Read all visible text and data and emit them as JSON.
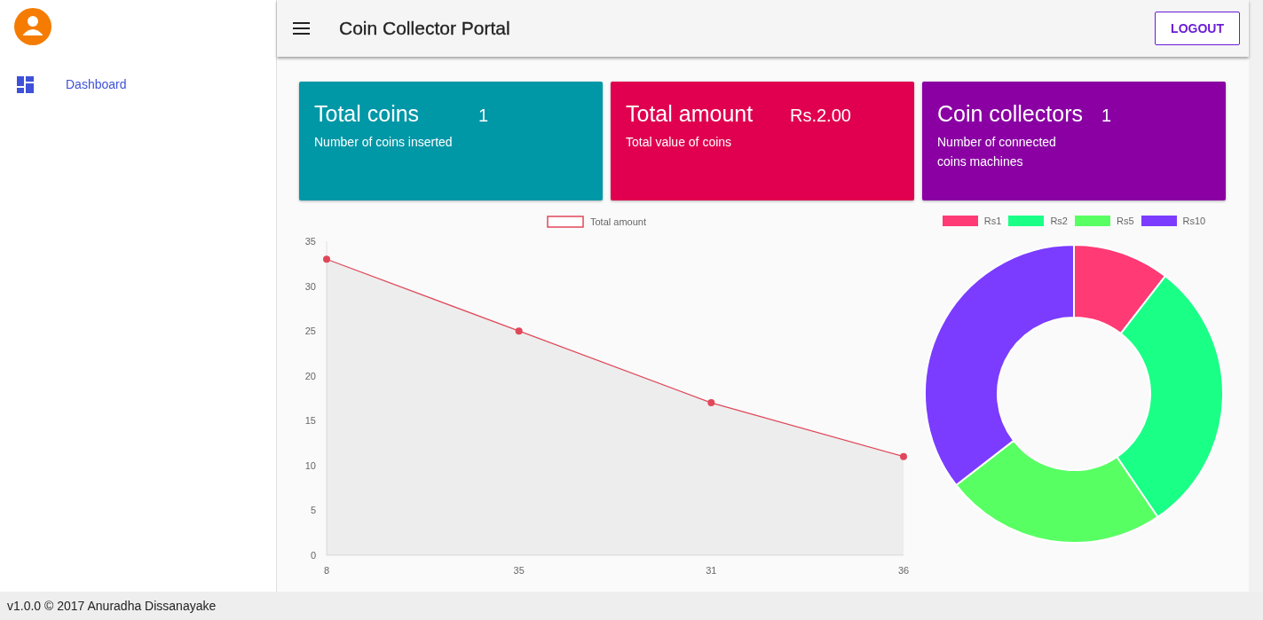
{
  "sidebar": {
    "items": [
      {
        "label": "Dashboard",
        "selected": true
      }
    ]
  },
  "header": {
    "title": "Coin Collector Portal",
    "logout_button": "LOGOUT"
  },
  "cards": [
    {
      "title": "Total coins",
      "value": "1",
      "subtitle": "Number of coins inserted",
      "color": "#0097a7"
    },
    {
      "title": "Total amount",
      "value": "Rs.2.00",
      "subtitle": "Total value of coins",
      "color": "#e0004f"
    },
    {
      "title": "Coin collectors",
      "value": "1",
      "subtitle": "Number of connected coins machines",
      "color": "#8a00a3"
    }
  ],
  "line_chart": {
    "chart_data": {
      "type": "area",
      "categories": [
        "8",
        "35",
        "31",
        "36"
      ],
      "series": [
        {
          "name": "Total amount",
          "color": "#e0485a",
          "values": [
            33,
            25,
            17,
            11
          ]
        }
      ],
      "ylim": [
        0,
        35
      ],
      "yticks": [
        0,
        5,
        10,
        15,
        20,
        25,
        30,
        35
      ]
    }
  },
  "donut_chart": {
    "legend": [
      {
        "label": "Rs1",
        "color": "#ff3a74"
      },
      {
        "label": "Rs2",
        "color": "#1aff86"
      },
      {
        "label": "Rs5",
        "color": "#58ff63"
      },
      {
        "label": "Rs10",
        "color": "#7b3cff"
      }
    ]
  },
  "footer": {
    "text": "v1.0.0 © 2017 Anuradha Dissanayake"
  }
}
